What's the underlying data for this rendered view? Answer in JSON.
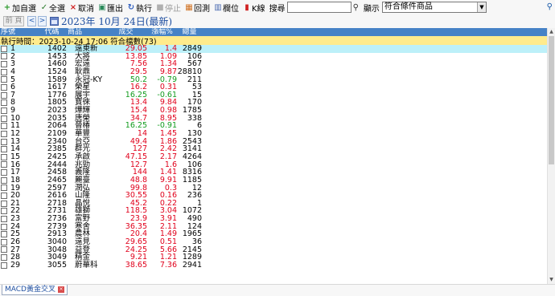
{
  "toolbar": {
    "add_watch": "加自選",
    "select_all": "全選",
    "cancel": "取消",
    "export": "匯出",
    "execute": "執行",
    "stop": "停止",
    "backtest": "回測",
    "columns": "欄位",
    "kline": "K線",
    "search_label": "搜尋",
    "search_value": "",
    "display_label": "顯示",
    "display_value": "符合條件商品"
  },
  "datebar": {
    "prev_page": "前 頁",
    "date_text": "2023年 10月 24日(最新)"
  },
  "table": {
    "headers": {
      "idx": "序號",
      "code": "代碼",
      "name": "商品",
      "price": "成交",
      "chg": "漲幅%",
      "vol": "總量"
    },
    "info": "執行時間：2023-10-24 17:06 符合檔數(73)",
    "rows": [
      {
        "idx": "1",
        "code": "1402",
        "name": "遠東新",
        "price": "29.05",
        "chg": "1.4",
        "vol": "2849",
        "dir": "up"
      },
      {
        "idx": "2",
        "code": "1453",
        "name": "大將",
        "price": "13.85",
        "chg": "1.09",
        "vol": "106",
        "dir": "up"
      },
      {
        "idx": "3",
        "code": "1460",
        "name": "宏遠",
        "price": "7.56",
        "chg": "1.34",
        "vol": "567",
        "dir": "up"
      },
      {
        "idx": "4",
        "code": "1524",
        "name": "耿鼎",
        "price": "29.5",
        "chg": "9.87",
        "vol": "28810",
        "dir": "up"
      },
      {
        "idx": "5",
        "code": "1589",
        "name": "永冠-KY",
        "price": "50.2",
        "chg": "-0.79",
        "vol": "211",
        "dir": "down"
      },
      {
        "idx": "6",
        "code": "1617",
        "name": "榮星",
        "price": "16.2",
        "chg": "0.31",
        "vol": "53",
        "dir": "up"
      },
      {
        "idx": "7",
        "code": "1776",
        "name": "展宇",
        "price": "16.25",
        "chg": "-0.61",
        "vol": "15",
        "dir": "down"
      },
      {
        "idx": "8",
        "code": "1805",
        "name": "寶徠",
        "price": "13.4",
        "chg": "9.84",
        "vol": "170",
        "dir": "up"
      },
      {
        "idx": "9",
        "code": "2023",
        "name": "燁輝",
        "price": "15.4",
        "chg": "0.98",
        "vol": "1785",
        "dir": "up"
      },
      {
        "idx": "10",
        "code": "2035",
        "name": "唐榮",
        "price": "34.7",
        "chg": "8.95",
        "vol": "338",
        "dir": "up"
      },
      {
        "idx": "11",
        "code": "2064",
        "name": "晉椿",
        "price": "16.25",
        "chg": "-0.91",
        "vol": "6",
        "dir": "down"
      },
      {
        "idx": "12",
        "code": "2109",
        "name": "華豐",
        "price": "14",
        "chg": "1.45",
        "vol": "130",
        "dir": "up"
      },
      {
        "idx": "13",
        "code": "2340",
        "name": "台亞",
        "price": "49.4",
        "chg": "1.86",
        "vol": "2543",
        "dir": "up"
      },
      {
        "idx": "14",
        "code": "2385",
        "name": "群光",
        "price": "127",
        "chg": "2.42",
        "vol": "3141",
        "dir": "up"
      },
      {
        "idx": "15",
        "code": "2425",
        "name": "承啟",
        "price": "47.15",
        "chg": "2.17",
        "vol": "4264",
        "dir": "up"
      },
      {
        "idx": "16",
        "code": "2444",
        "name": "兆勁",
        "price": "12.7",
        "chg": "1.6",
        "vol": "106",
        "dir": "up"
      },
      {
        "idx": "17",
        "code": "2458",
        "name": "義隆",
        "price": "144",
        "chg": "1.41",
        "vol": "8316",
        "dir": "up"
      },
      {
        "idx": "18",
        "code": "2465",
        "name": "麗臺",
        "price": "48.8",
        "chg": "9.91",
        "vol": "1185",
        "dir": "up"
      },
      {
        "idx": "19",
        "code": "2597",
        "name": "潤弘",
        "price": "99.8",
        "chg": "0.3",
        "vol": "12",
        "dir": "up"
      },
      {
        "idx": "20",
        "code": "2616",
        "name": "山隆",
        "price": "30.55",
        "chg": "0.16",
        "vol": "236",
        "dir": "up"
      },
      {
        "idx": "21",
        "code": "2718",
        "name": "晶悅",
        "price": "45.2",
        "chg": "0.22",
        "vol": "1",
        "dir": "up"
      },
      {
        "idx": "22",
        "code": "2731",
        "name": "雄獅",
        "price": "118.5",
        "chg": "3.04",
        "vol": "1072",
        "dir": "up"
      },
      {
        "idx": "23",
        "code": "2736",
        "name": "富野",
        "price": "23.9",
        "chg": "3.91",
        "vol": "490",
        "dir": "up"
      },
      {
        "idx": "24",
        "code": "2739",
        "name": "寒舍",
        "price": "36.35",
        "chg": "2.11",
        "vol": "124",
        "dir": "up"
      },
      {
        "idx": "25",
        "code": "2913",
        "name": "農林",
        "price": "20.4",
        "chg": "1.49",
        "vol": "1965",
        "dir": "up"
      },
      {
        "idx": "26",
        "code": "3040",
        "name": "遠見",
        "price": "29.65",
        "chg": "0.51",
        "vol": "36",
        "dir": "up"
      },
      {
        "idx": "27",
        "code": "3048",
        "name": "益登",
        "price": "24.25",
        "chg": "5.66",
        "vol": "2145",
        "dir": "up"
      },
      {
        "idx": "28",
        "code": "3049",
        "name": "精金",
        "price": "9.21",
        "chg": "1.21",
        "vol": "1289",
        "dir": "up"
      },
      {
        "idx": "29",
        "code": "3055",
        "name": "蔚華科",
        "price": "38.65",
        "chg": "7.36",
        "vol": "2941",
        "dir": "up"
      }
    ]
  },
  "tabs": {
    "macd": "MACD黃金交叉"
  },
  "colors": {
    "up": "#e0001b",
    "down": "#119b1d",
    "header": "#4682c6",
    "info": "#ffeb8c",
    "selected": "#bdf0f9"
  }
}
